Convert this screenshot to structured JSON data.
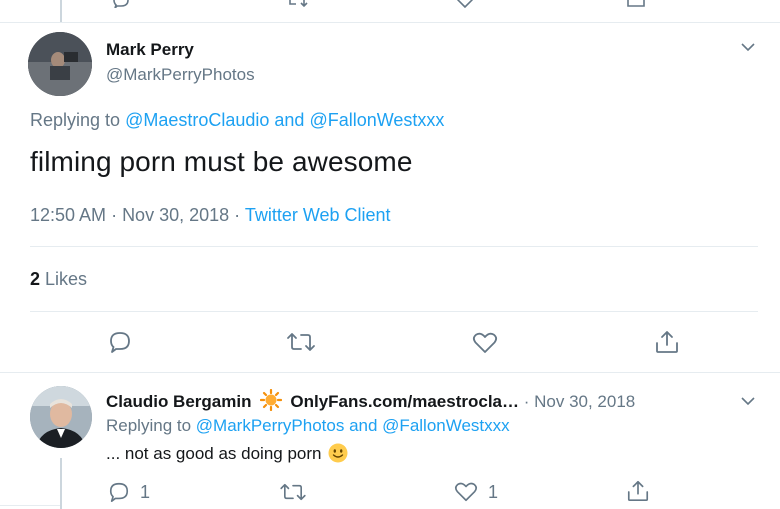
{
  "main_tweet": {
    "author_name": "Mark Perry",
    "author_handle": "@MarkPerryPhotos",
    "replying_prefix": "Replying to ",
    "replying_to_1": "@MaestroClaudio",
    "replying_and": " and ",
    "replying_to_2": "@FallonWestxxx",
    "text": "filming porn must be awesome",
    "time": "12:50 AM",
    "date": "Nov 30, 2018",
    "client": "Twitter Web Client",
    "sep": " · ",
    "likes_count": "2",
    "likes_label": " Likes"
  },
  "reply_tweet": {
    "author_name": "Claudio Bergamin",
    "author_suffix": "OnlyFans.com/maestrocla…",
    "sep": " · ",
    "date": "Nov 30, 2018",
    "replying_prefix": "Replying to ",
    "replying_to_1": "@MarkPerryPhotos",
    "replying_and": " and ",
    "replying_to_2": "@FallonWestxxx",
    "text": "... not as good as doing porn",
    "reply_count": "1",
    "like_count": "1"
  },
  "icons": [
    "reply-icon",
    "retweet-icon",
    "like-icon",
    "share-icon",
    "chevron-down-icon",
    "sun-emoji-icon",
    "slight-smile-emoji-icon"
  ],
  "colors": {
    "link": "#1da1f2",
    "muted": "#657786",
    "text": "#14171a",
    "divider": "#e6ecf0"
  }
}
